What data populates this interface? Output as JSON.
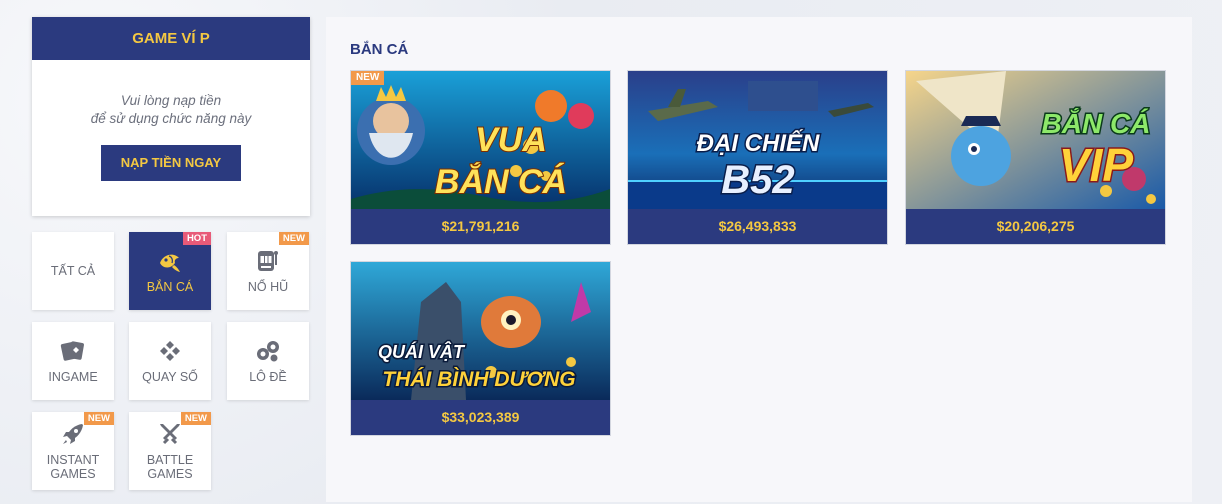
{
  "vip_panel": {
    "title": "GAME VÍ P",
    "message_line1": "Vui lòng nạp tiền",
    "message_line2": "để sử dụng chức năng này",
    "button_label": "NẠP TIỀN NGAY"
  },
  "categories": [
    {
      "label": "TẤT CẢ",
      "icon": "none",
      "badge": "",
      "active": false
    },
    {
      "label": "BẮN CÁ",
      "icon": "fish-icon",
      "badge": "HOT",
      "active": true
    },
    {
      "label": "NỔ HŨ",
      "icon": "slot-machine-icon",
      "badge": "NEW",
      "active": false
    },
    {
      "label": "INGAME",
      "icon": "cards-icon",
      "badge": "",
      "active": false
    },
    {
      "label": "QUAY SỐ",
      "icon": "clover-icon",
      "badge": "",
      "active": false
    },
    {
      "label": "LÔ ĐỀ",
      "icon": "lottery-balls-icon",
      "badge": "",
      "active": false
    },
    {
      "label_line1": "INSTANT",
      "label_line2": "GAMES",
      "icon": "rocket-icon",
      "badge": "NEW",
      "active": false
    },
    {
      "label_line1": "BATTLE",
      "label_line2": "GAMES",
      "icon": "crossed-swords-icon",
      "badge": "NEW",
      "active": false
    }
  ],
  "section": {
    "title": "BẮN CÁ"
  },
  "games": [
    {
      "title_line1": "VUA",
      "title_line2": "BẮN CÁ",
      "jackpot": "$21,791,216",
      "tag": "NEW"
    },
    {
      "title_line1": "ĐẠI CHIẾN",
      "title_line2": "B52",
      "jackpot": "$26,493,833",
      "tag": ""
    },
    {
      "title_line1": "BẮN CÁ",
      "title_line2": "VIP",
      "jackpot": "$20,206,275",
      "tag": ""
    },
    {
      "title_line1": "QUÁI VẬT",
      "title_line2": "THÁI BÌNH DƯƠNG",
      "jackpot": "$33,023,389",
      "tag": ""
    }
  ],
  "colors": {
    "brand_navy": "#2b3a7f",
    "accent_gold": "#f4c842",
    "badge_new": "#f2994a",
    "badge_hot": "#e85a78"
  }
}
